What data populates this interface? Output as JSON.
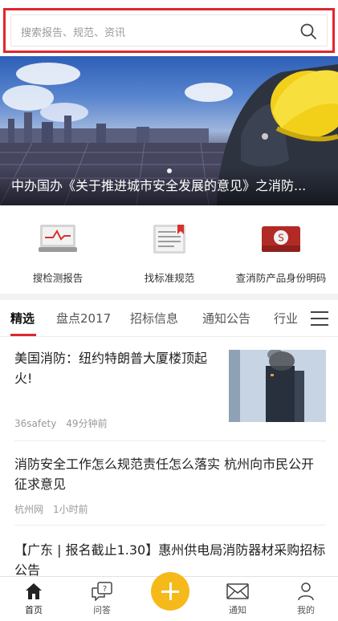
{
  "search": {
    "placeholder": "搜索报告、规范、资讯"
  },
  "banner": {
    "title": "中办国办《关于推进城市安全发展的意见》之消防..."
  },
  "quick_entries": [
    {
      "label": "搜检测报告",
      "icon": "report-monitor-icon"
    },
    {
      "label": "找标准规范",
      "icon": "standard-document-icon"
    },
    {
      "label": "查消防产品身份明码",
      "icon": "product-id-card-icon"
    }
  ],
  "tabs": [
    {
      "label": "精选"
    },
    {
      "label": "盘点2017"
    },
    {
      "label": "招标信息"
    },
    {
      "label": "通知公告"
    },
    {
      "label": "行业"
    }
  ],
  "news": [
    {
      "title": "美国消防：纽约特朗普大厦楼顶起火!",
      "source": "36safety",
      "time": "49分钟前",
      "has_thumb": true
    },
    {
      "title": "消防安全工作怎么规范责任怎么落实 杭州向市民公开征求意见",
      "source": "杭州网",
      "time": "1小时前"
    },
    {
      "title": "【广东 | 报名截止1.30】惠州供电局消防器材采购招标公告"
    }
  ],
  "bottom_nav": [
    {
      "label": "首页",
      "icon": "home-icon"
    },
    {
      "label": "问答",
      "icon": "question-chat-icon"
    },
    {
      "label": "",
      "icon": "plus-icon"
    },
    {
      "label": "通知",
      "icon": "mail-icon"
    },
    {
      "label": "我的",
      "icon": "user-icon"
    }
  ],
  "colors": {
    "accent_red": "#e0262e",
    "fab_yellow": "#f5b91a",
    "helmet_yellow": "#f2d01a"
  }
}
